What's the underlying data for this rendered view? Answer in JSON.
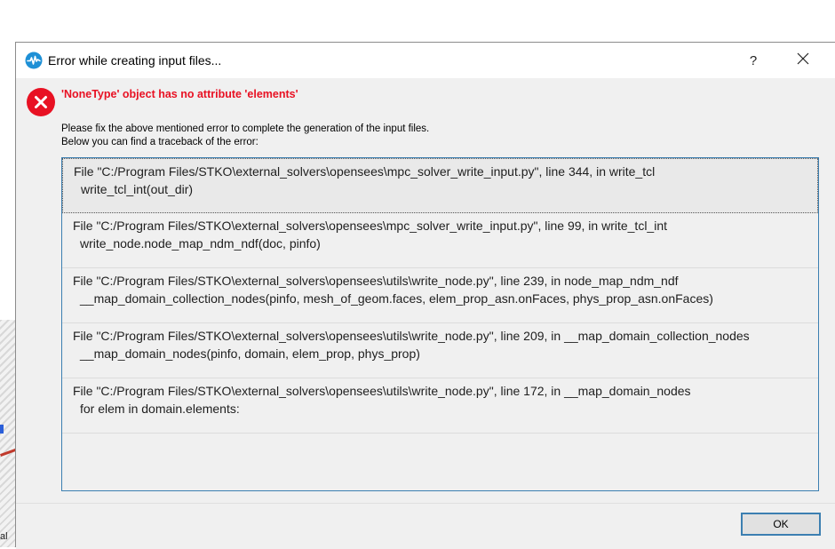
{
  "background": {
    "label": "al"
  },
  "dialog": {
    "title": "Error while creating input files...",
    "help_label": "?",
    "error_title": "'NoneType' object has no attribute 'elements'",
    "instructions": [
      "Please fix the above mentioned error to complete the generation of the input files.",
      "Below you can find a traceback of the error:"
    ],
    "traceback": [
      {
        "file_line": "File \"C:/Program Files/STKO\\external_solvers\\opensees\\mpc_solver_write_input.py\", line 344, in write_tcl",
        "code": "write_tcl_int(out_dir)"
      },
      {
        "file_line": "File \"C:/Program Files/STKO\\external_solvers\\opensees\\mpc_solver_write_input.py\", line 99, in write_tcl_int",
        "code": "write_node.node_map_ndm_ndf(doc, pinfo)"
      },
      {
        "file_line": "File \"C:/Program Files/STKO\\external_solvers\\opensees\\utils\\write_node.py\", line 239, in node_map_ndm_ndf",
        "code": "__map_domain_collection_nodes(pinfo, mesh_of_geom.faces, elem_prop_asn.onFaces, phys_prop_asn.onFaces)"
      },
      {
        "file_line": "File \"C:/Program Files/STKO\\external_solvers\\opensees\\utils\\write_node.py\", line 209, in __map_domain_collection_nodes",
        "code": "__map_domain_nodes(pinfo, domain, elem_prop, phys_prop)"
      },
      {
        "file_line": "File \"C:/Program Files/STKO\\external_solvers\\opensees\\utils\\write_node.py\", line 172, in __map_domain_nodes",
        "code": "for elem in domain.elements:"
      }
    ],
    "ok_label": "OK"
  },
  "colors": {
    "error_red": "#e81123",
    "accent_blue": "#3c7fb1",
    "app_icon_blue": "#1e90d6"
  },
  "icons": {
    "app": "waveform-icon",
    "error": "error-circle-x-icon",
    "close": "close-icon"
  }
}
